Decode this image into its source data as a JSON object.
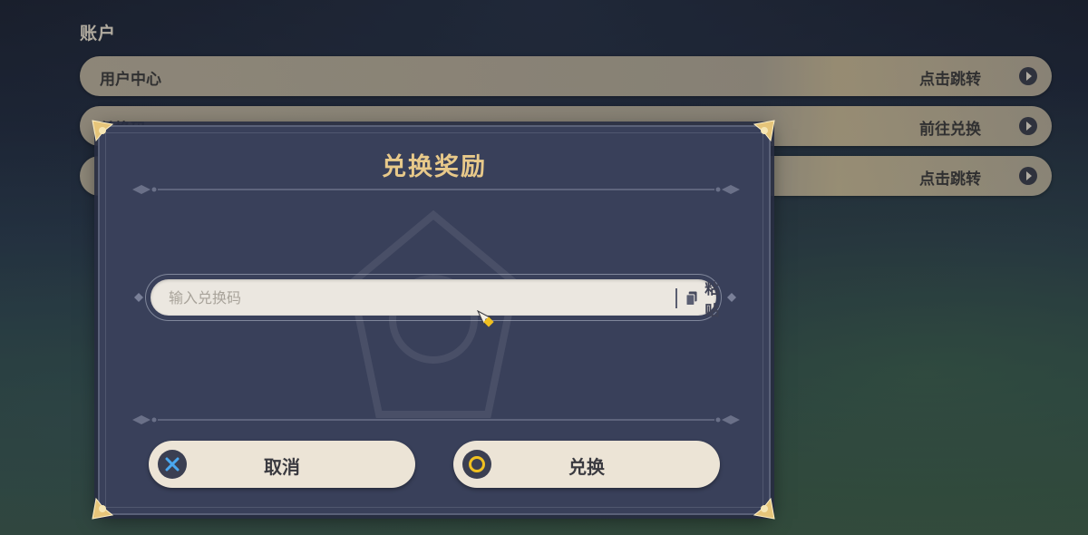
{
  "section": {
    "title": "账户"
  },
  "rows": [
    {
      "label": "用户中心",
      "action": "点击跳转"
    },
    {
      "label": "兑换码",
      "action": "前往兑换"
    },
    {
      "label": "",
      "action": "点击跳转"
    }
  ],
  "dialog": {
    "title": "兑换奖励",
    "input_placeholder": "输入兑换码",
    "input_value": "",
    "paste_label": "粘贴",
    "cancel_label": "取消",
    "confirm_label": "兑换"
  },
  "icons": {
    "row_arrow": "chevron-right-icon",
    "paste": "clipboard-icon",
    "cancel": "x-icon",
    "confirm": "circle-icon"
  },
  "colors": {
    "dialog_bg": "#39405a",
    "title_gold": "#e8c98a",
    "button_bg": "#ece4d6",
    "cancel_icon": "#4aa8f0",
    "confirm_icon": "#f0c020"
  }
}
